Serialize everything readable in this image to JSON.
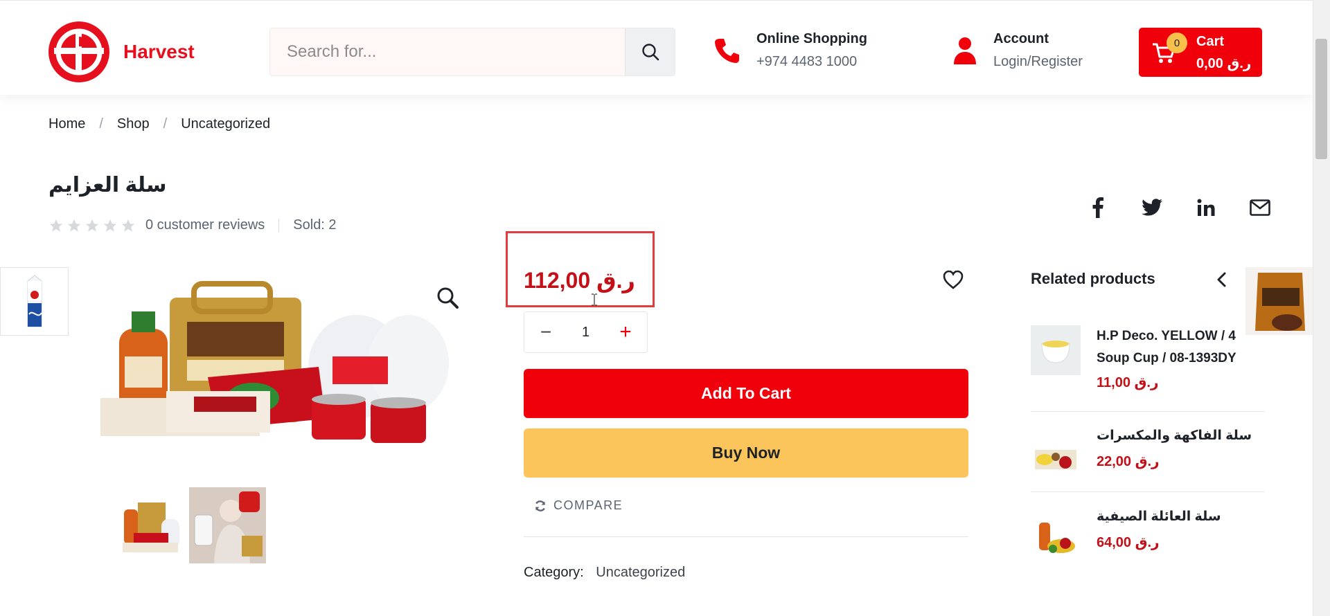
{
  "brand": {
    "name": "Harvest",
    "color": "#e60f1e"
  },
  "search": {
    "placeholder": "Search for..."
  },
  "contact": {
    "title": "Online Shopping",
    "phone": "+974 4483 1000"
  },
  "account": {
    "title": "Account",
    "link": "Login/Register"
  },
  "cart": {
    "count": "0",
    "label": "Cart",
    "total": "0,00 ر.ق"
  },
  "breadcrumb": {
    "home": "Home",
    "shop": "Shop",
    "current": "Uncategorized"
  },
  "product": {
    "title": "سلة العزايم",
    "reviews": "0 customer reviews",
    "sold": "Sold: 2",
    "price": "112,00 ر.ق",
    "quantity": "1",
    "add_to_cart": "Add To Cart",
    "buy_now": "Buy Now",
    "compare": "COMPARE",
    "category_label": "Category:",
    "category_value": "Uncategorized"
  },
  "related": {
    "title": "Related products",
    "items": [
      {
        "name_line1": "H.P Deco. YELLOW / 4",
        "name_line2": "Soup Cup / 08-1393DY",
        "price": "11,00 ر.ق"
      },
      {
        "name": "سلة الفاكهة والمكسرات",
        "price": "22,00 ر.ق"
      },
      {
        "name": "سلة العائلة الصيفية",
        "price": "64,00 ر.ق"
      }
    ]
  },
  "colors": {
    "primary": "#f0000b",
    "accent": "#fcc55b",
    "price": "#c40f17"
  }
}
